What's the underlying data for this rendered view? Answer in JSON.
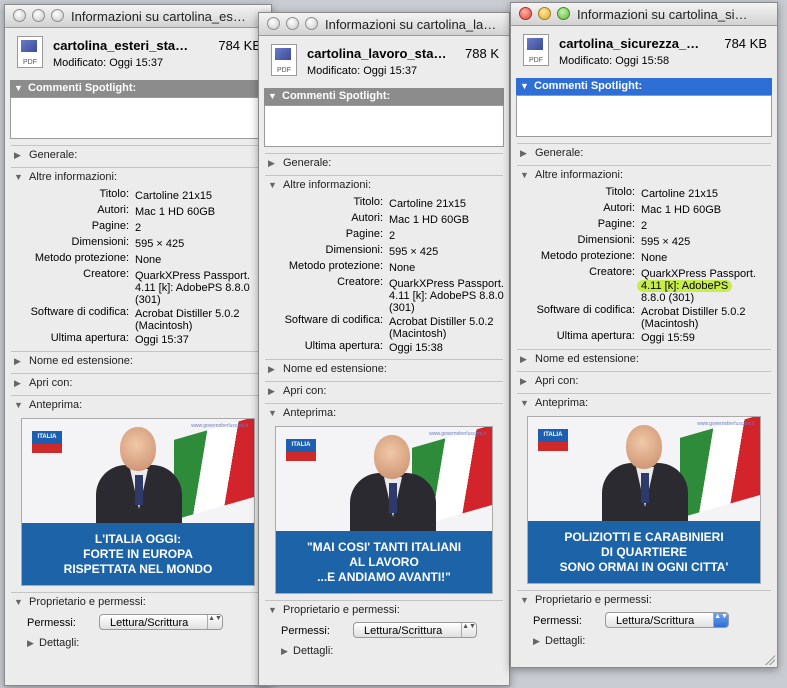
{
  "windows": [
    {
      "title": "Informazioni su cartolina_es…",
      "file_name": "cartolina_esteri_sta…",
      "file_size": "784 KB",
      "modified": "Modificato: Oggi 15:37",
      "spotlight_label": "Commenti Spotlight:",
      "sections": {
        "general": "Generale:",
        "more_info": "Altre informazioni:",
        "name_ext": "Nome ed estensione:",
        "open_with": "Apri con:",
        "preview": "Anteprima:",
        "owner": "Proprietario e permessi:",
        "details": "Dettagli:"
      },
      "info": [
        {
          "key": "Titolo:",
          "value": "Cartoline 21x15"
        },
        {
          "key": "Autori:",
          "value": "Mac 1 HD 60GB"
        },
        {
          "key": "Pagine:",
          "value": "2"
        },
        {
          "key": "Dimensioni:",
          "value": "595 × 425"
        },
        {
          "key": "Metodo protezione:",
          "value": "None"
        },
        {
          "key": "Creatore:",
          "value": "QuarkXPress Passport. 4.11 [k]: AdobePS 8.8.0 (301)"
        },
        {
          "key": "Software di codifica:",
          "value": "Acrobat Distiller 5.0.2 (Macintosh)"
        },
        {
          "key": "Ultima apertura:",
          "value": "Oggi 15:37"
        }
      ],
      "banner_lines": [
        "L'ITALIA OGGI:",
        "FORTE IN EUROPA",
        "RISPETTATA NEL MONDO"
      ],
      "logo_text": "ITALIA",
      "url_text": "www.governoberlusconi.it",
      "perm_label": "Permessi:",
      "perm_value": "Lettura/Scrittura"
    },
    {
      "title": "Informazioni su cartolina_la…",
      "file_name": "cartolina_lavoro_sta…",
      "file_size": "788 K",
      "modified": "Modificato: Oggi 15:37",
      "spotlight_label": "Commenti Spotlight:",
      "sections": {
        "general": "Generale:",
        "more_info": "Altre informazioni:",
        "name_ext": "Nome ed estensione:",
        "open_with": "Apri con:",
        "preview": "Anteprima:",
        "owner": "Proprietario e permessi:",
        "details": "Dettagli:"
      },
      "info": [
        {
          "key": "Titolo:",
          "value": "Cartoline 21x15"
        },
        {
          "key": "Autori:",
          "value": "Mac 1 HD 60GB"
        },
        {
          "key": "Pagine:",
          "value": "2"
        },
        {
          "key": "Dimensioni:",
          "value": "595 × 425"
        },
        {
          "key": "Metodo protezione:",
          "value": "None"
        },
        {
          "key": "Creatore:",
          "value": "QuarkXPress Passport. 4.11 [k]: AdobePS 8.8.0 (301)"
        },
        {
          "key": "Software di codifica:",
          "value": "Acrobat Distiller 5.0.2 (Macintosh)"
        },
        {
          "key": "Ultima apertura:",
          "value": "Oggi 15:38"
        }
      ],
      "banner_lines": [
        "\"MAI COSI' TANTI ITALIANI",
        "AL LAVORO",
        "...E ANDIAMO AVANTI!\""
      ],
      "logo_text": "ITALIA",
      "url_text": "www.governoberlusconi.it",
      "perm_label": "Permessi:",
      "perm_value": "Lettura/Scrittura"
    },
    {
      "title": "Informazioni su cartolina_si…",
      "file_name": "cartolina_sicurezza_…",
      "file_size": "784 KB",
      "modified": "Modificato: Oggi 15:58",
      "spotlight_label": "Commenti Spotlight:",
      "sections": {
        "general": "Generale:",
        "more_info": "Altre informazioni:",
        "name_ext": "Nome ed estensione:",
        "open_with": "Apri con:",
        "preview": "Anteprima:",
        "owner": "Proprietario e permessi:",
        "details": "Dettagli:"
      },
      "info": [
        {
          "key": "Titolo:",
          "value": "Cartoline 21x15"
        },
        {
          "key": "Autori:",
          "value": "Mac 1 HD 60GB"
        },
        {
          "key": "Pagine:",
          "value": "2"
        },
        {
          "key": "Dimensioni:",
          "value": "595 × 425"
        },
        {
          "key": "Metodo protezione:",
          "value": "None"
        }
      ],
      "creator_key": "Creatore:",
      "creator_line1": "QuarkXPress Passport.",
      "creator_line2": "4.11 [k]: AdobePS",
      "creator_line3": "8.8.0 (301)",
      "info_after": [
        {
          "key": "Software di codifica:",
          "value": "Acrobat Distiller 5.0.2 (Macintosh)"
        },
        {
          "key": "Ultima apertura:",
          "value": "Oggi 15:59"
        }
      ],
      "banner_lines": [
        "POLIZIOTTI E CARABINIERI",
        "DI QUARTIERE",
        "SONO ORMAI IN OGNI CITTA'"
      ],
      "logo_text": "ITALIA",
      "url_text": "www.governoberlusconi.it",
      "perm_label": "Permessi:",
      "perm_value": "Lettura/Scrittura"
    }
  ],
  "icons": {
    "pdf_label": "PDF",
    "disclosure_open": "▼",
    "disclosure_closed": "▶",
    "popup_arrows": "▲▼"
  },
  "colors": {
    "selection": "#2e6fd6",
    "highlight": "#c8ec4a",
    "banner": "#1d63a8"
  }
}
